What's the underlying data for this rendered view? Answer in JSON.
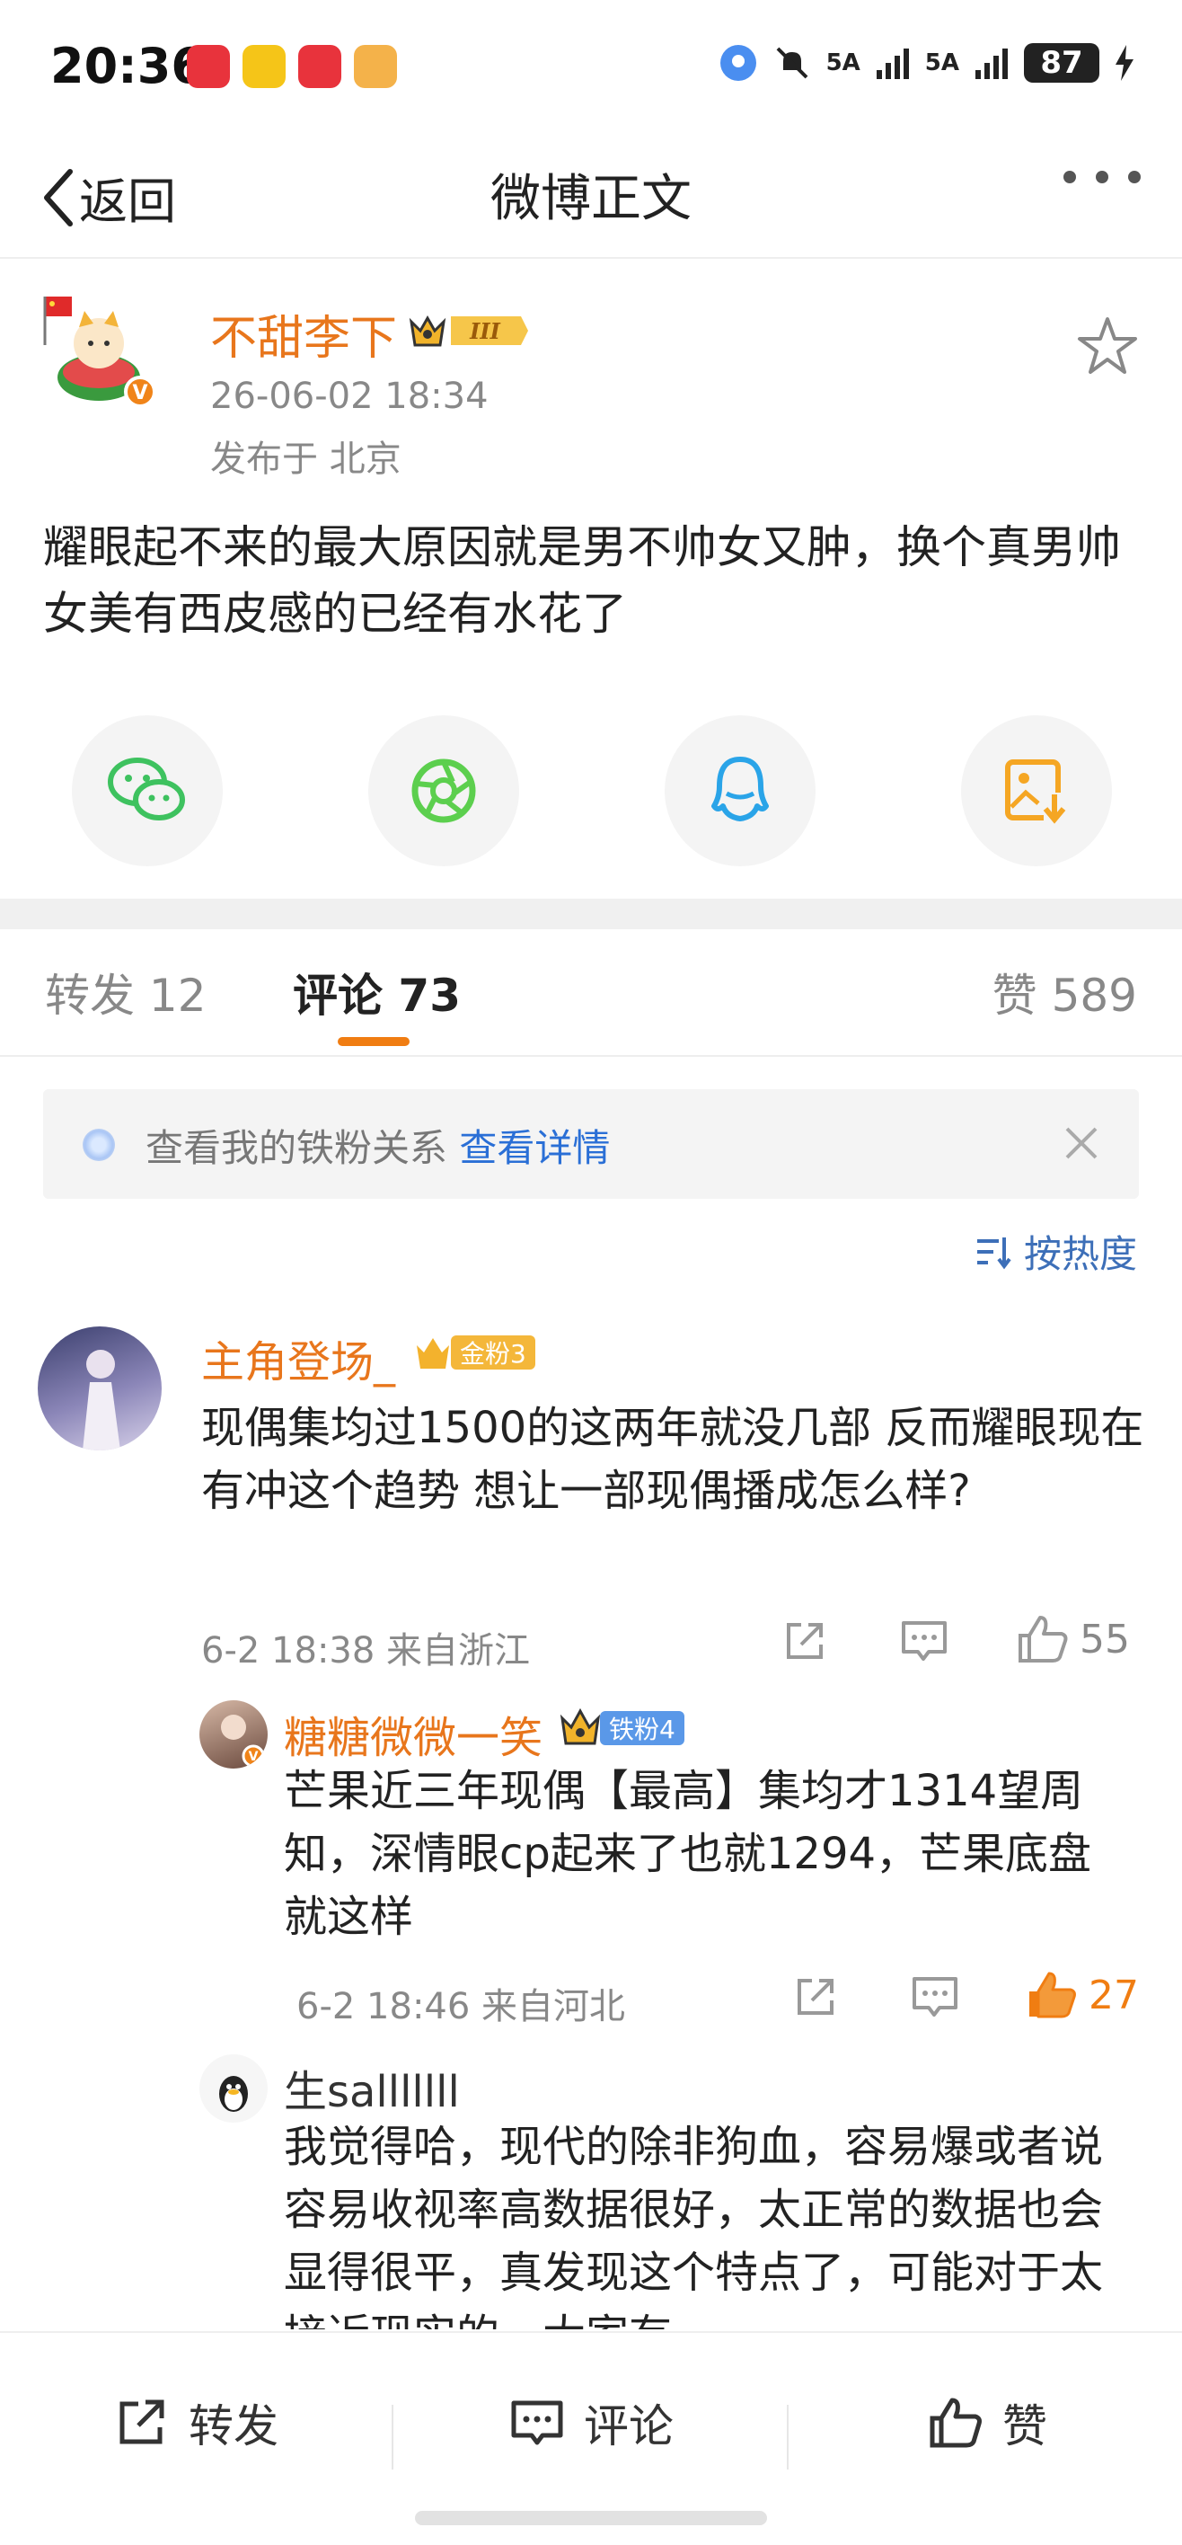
{
  "status_bar": {
    "time": "20:36",
    "battery": "87",
    "signal1": "5A",
    "signal2": "5A"
  },
  "nav": {
    "back_label": "返回",
    "title": "微博正文"
  },
  "post": {
    "author": "不甜李下",
    "time": "26-06-02 18:34",
    "location": "发布于 北京",
    "text": "耀眼起不来的最大原因就是男不帅女又肿，换个真男帅女美有西皮感的已经有水花了"
  },
  "share_icons": [
    "wechat-icon",
    "moments-icon",
    "qq-icon",
    "save-image-icon"
  ],
  "tabs": {
    "repost": {
      "label": "转发",
      "count": "12"
    },
    "comment": {
      "label": "评论",
      "count": "73"
    },
    "like": {
      "label": "赞",
      "count": "589"
    }
  },
  "banner": {
    "text": "查看我的铁粉关系",
    "link": "查看详情"
  },
  "sort_label": "按热度",
  "comments": [
    {
      "name": "主角登场_",
      "badge": "金粉3",
      "text": "现偶集均过1500的这两年就没几部 反而耀眼现在有冲这个趋势 想让一部现偶播成怎么样?",
      "meta": "6-2 18:38 来自浙江",
      "likes": "55"
    },
    {
      "name": "糖糖微微一笑",
      "badge": "铁粉4",
      "text": "芒果近三年现偶【最高】集均才1314望周知，深情眼cp起来了也就1294，芒果底盘就这样",
      "meta": "6-2 18:46 来自河北",
      "likes": "27"
    },
    {
      "name": "生salllllll",
      "text": "我觉得哈，现代的除非狗血，容易爆或者说容易收视率高数据很好，太正常的数据也会显得很平，真发现这个特点了，可能对于太接近现实的，大家有"
    }
  ],
  "bottom_bar": {
    "repost": "转发",
    "comment": "评论",
    "like": "赞"
  },
  "colors": {
    "accent_orange": "#f07d12",
    "name_orange": "#e8761c",
    "link_blue": "#2a6fd6"
  }
}
